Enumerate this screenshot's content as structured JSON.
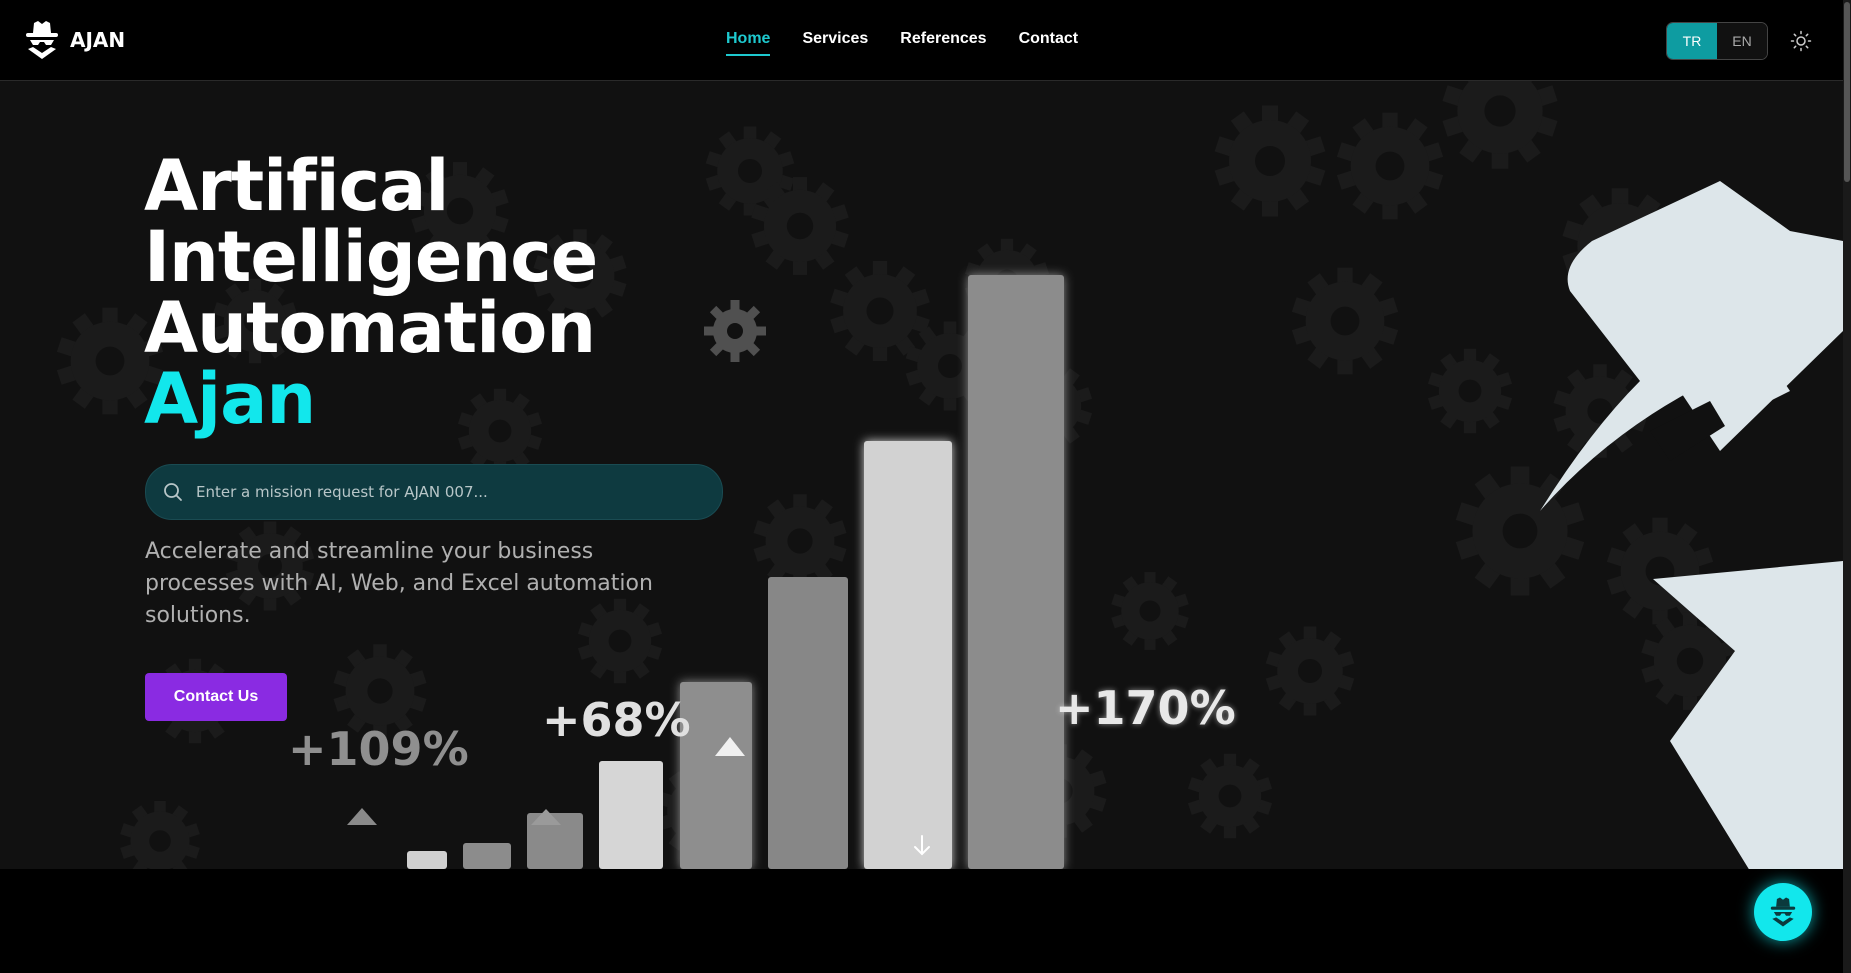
{
  "header": {
    "brand": "AJAN",
    "nav": [
      {
        "label": "Home",
        "active": true
      },
      {
        "label": "Services",
        "active": false
      },
      {
        "label": "References",
        "active": false
      },
      {
        "label": "Contact",
        "active": false
      }
    ],
    "languages": [
      {
        "label": "TR",
        "active": true
      },
      {
        "label": "EN",
        "active": false
      }
    ],
    "theme_icon": "sun-icon"
  },
  "hero": {
    "title_lines": [
      "Artifical",
      "Intelligence",
      "Automation"
    ],
    "title_accent": "Ajan",
    "search": {
      "placeholder": "Enter a mission request for AJAN 007...",
      "value": ""
    },
    "description": "Accelerate and streamline your business processes with AI, Web, and Excel automation solutions.",
    "cta_label": "Contact Us"
  },
  "graphic": {
    "stats": [
      "+109%",
      "+68%",
      "+170%"
    ],
    "scroll_icon": "arrow-down-icon"
  },
  "colors": {
    "accent": "#12e7ec",
    "cta": "#8a2be2",
    "background": "#111111"
  },
  "fab_icon": "agent-icon"
}
